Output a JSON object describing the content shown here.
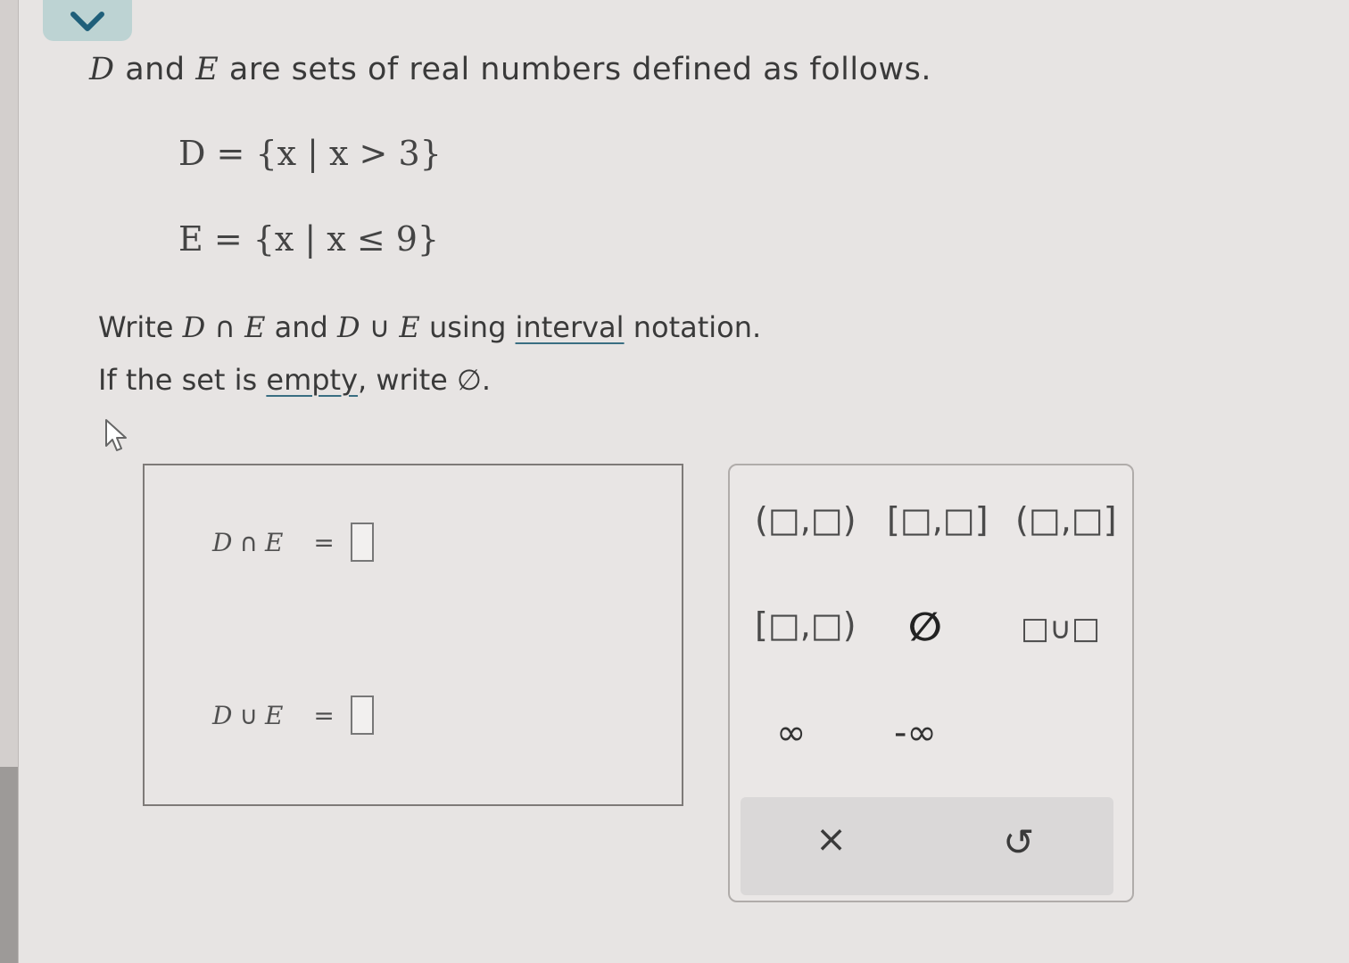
{
  "problem": {
    "intro_D": "D",
    "intro_and": "and",
    "intro_E": "E",
    "intro_rest": "are sets of real numbers defined as follows.",
    "set_D": "D = {x | x > 3}",
    "set_E": "E = {x | x ≤ 9}",
    "instruction_write": "Write",
    "instruction_D1": "D",
    "instruction_cap": "∩",
    "instruction_E1": "E",
    "instruction_and": "and",
    "instruction_D2": "D",
    "instruction_cup": "∪",
    "instruction_E2": "E",
    "instruction_using": "using",
    "instruction_link": "interval",
    "instruction_notation": "notation.",
    "empty_pre": "If the set is",
    "empty_link": "empty",
    "empty_mid": ", write",
    "empty_symbol": "∅",
    "empty_post": "."
  },
  "answers": {
    "intersection": {
      "D": "D",
      "op": "∩",
      "E": "E",
      "eq": "=",
      "value": ""
    },
    "union": {
      "D": "D",
      "op": "∪",
      "E": "E",
      "eq": "=",
      "value": ""
    }
  },
  "palette": {
    "open_open": "(□,□)",
    "closed_closed": "[□,□]",
    "open_closed": "(□,□]",
    "closed_open": "[□,□)",
    "empty_set": "∅",
    "union": "□∪□",
    "infinity": "∞",
    "neg_infinity": "-∞",
    "clear": "×",
    "undo": "↺"
  },
  "icons": {
    "collapse": "chevron-down-icon",
    "cursor": "pointer-cursor-icon"
  },
  "colors": {
    "accent": "#1f5f7a",
    "tab": "#bdd3d3"
  }
}
